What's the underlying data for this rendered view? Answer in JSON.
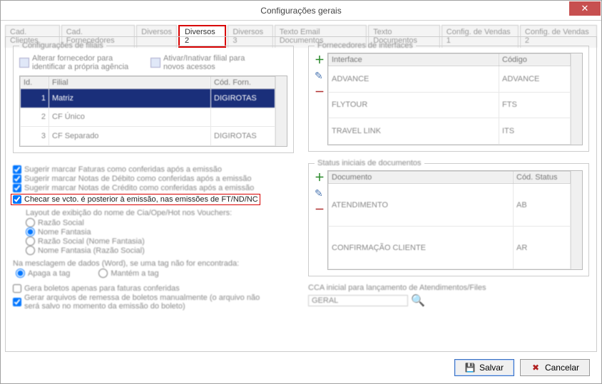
{
  "window": {
    "title": "Configurações gerais"
  },
  "tabs": {
    "items": [
      {
        "label": "Cad. Clientes"
      },
      {
        "label": "Cad. Fornecedores"
      },
      {
        "label": "Diversos"
      },
      {
        "label": "Diversos 2"
      },
      {
        "label": "Diversos 3"
      },
      {
        "label": "Texto Email Documentos"
      },
      {
        "label": "Texto Documentos"
      },
      {
        "label": "Config. de Vendas 1"
      },
      {
        "label": "Config. de Vendas 2"
      }
    ],
    "active_index": 3
  },
  "filiais": {
    "legend": "Configurações de filiais",
    "btn1": "Alterar fornecedor para identificar a própria agência",
    "btn2": "Ativar/Inativar filial para novos acessos",
    "headers": {
      "id": "Id.",
      "filial": "Filial",
      "cod": "Cód. Forn."
    },
    "rows": [
      {
        "id": "1",
        "filial": "Matriz",
        "cod": "DIGIROTAS"
      },
      {
        "id": "2",
        "filial": "CF Único",
        "cod": ""
      },
      {
        "id": "3",
        "filial": "CF Separado",
        "cod": "DIGIROTAS"
      }
    ]
  },
  "checks": {
    "c1": "Sugerir marcar Faturas como conferidas após a emissão",
    "c2": "Sugerir marcar Notas de Débito como conferidas após a emissão",
    "c3": "Sugerir marcar Notas de Crédito como conferidas após a emissão",
    "c4": "Checar se vcto. é posterior à emissão, nas emissões de FT/ND/NC",
    "layout_label": "Layout de exibição do nome de Cia/Ope/Hot nos Vouchers:",
    "r1": "Razão Social",
    "r2": "Nome Fantasia",
    "r3": "Razão Social (Nome Fantasia)",
    "r4": "Nome Fantasia (Razão Social)",
    "merge_label": "Na mesclagem de dados (Word), se uma tag não for encontrada:",
    "m1": "Apaga a tag",
    "m2": "Mantém a tag",
    "b1": "Gera boletos apenas para faturas conferidas",
    "b2": "Gerar arquivos de remessa de boletos manualmente (o arquivo não será salvo no momento da emissão do boleto)"
  },
  "fornecedores": {
    "legend": "Fornecedores de interfaces",
    "headers": {
      "int": "Interface",
      "cod": "Código"
    },
    "rows": [
      {
        "int": "ADVANCE",
        "cod": "ADVANCE"
      },
      {
        "int": "FLYTOUR",
        "cod": "FTS"
      },
      {
        "int": "TRAVEL LINK",
        "cod": "ITS"
      }
    ]
  },
  "status": {
    "legend": "Status iniciais de documentos",
    "headers": {
      "doc": "Documento",
      "cod": "Cód. Status"
    },
    "rows": [
      {
        "doc": "ATENDIMENTO",
        "cod": "AB"
      },
      {
        "doc": "CONFIRMAÇÃO CLIENTE",
        "cod": "AR"
      }
    ]
  },
  "cca": {
    "label": "CCA inicial para lançamento de Atendimentos/Files",
    "value": "GERAL"
  },
  "footer": {
    "save": "Salvar",
    "cancel": "Cancelar"
  }
}
